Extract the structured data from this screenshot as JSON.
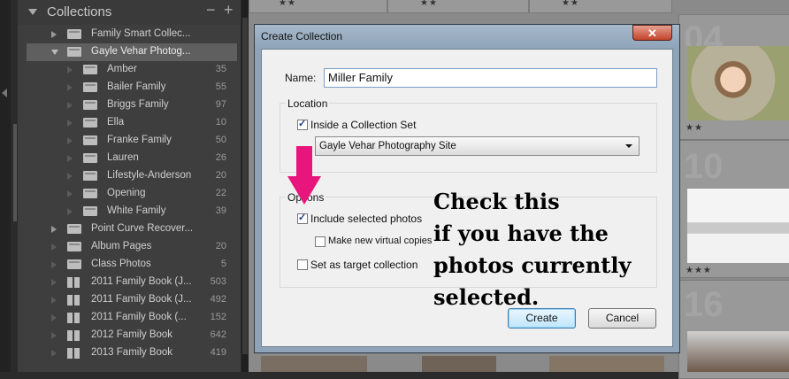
{
  "collections_panel": {
    "title": "Collections",
    "minus_label": "−",
    "plus_label": "+",
    "items": [
      {
        "label": "Family Smart Collec...",
        "count": "",
        "icon": "smart-collection-set-icon",
        "level": 0,
        "disclosure": "collapsed",
        "selected": false
      },
      {
        "label": "Gayle Vehar Photog...",
        "count": "",
        "icon": "collection-set-icon",
        "level": 0,
        "disclosure": "expanded",
        "selected": true
      },
      {
        "label": "Amber",
        "count": "35",
        "icon": "collection-icon",
        "level": 1,
        "disclosure": "none",
        "selected": false
      },
      {
        "label": "Bailer Family",
        "count": "55",
        "icon": "collection-icon",
        "level": 1,
        "disclosure": "none",
        "selected": false
      },
      {
        "label": "Briggs Family",
        "count": "97",
        "icon": "collection-icon",
        "level": 1,
        "disclosure": "none",
        "selected": false
      },
      {
        "label": "Ella",
        "count": "10",
        "icon": "collection-icon",
        "level": 1,
        "disclosure": "none",
        "selected": false
      },
      {
        "label": "Franke Family",
        "count": "50",
        "icon": "collection-icon",
        "level": 1,
        "disclosure": "none",
        "selected": false
      },
      {
        "label": "Lauren",
        "count": "26",
        "icon": "collection-icon",
        "level": 1,
        "disclosure": "none",
        "selected": false
      },
      {
        "label": "Lifestyle-Anderson",
        "count": "20",
        "icon": "collection-icon",
        "level": 1,
        "disclosure": "none",
        "selected": false
      },
      {
        "label": "Opening",
        "count": "22",
        "icon": "collection-icon",
        "level": 1,
        "disclosure": "none",
        "selected": false
      },
      {
        "label": "White Family",
        "count": "39",
        "icon": "collection-icon",
        "level": 1,
        "disclosure": "none",
        "selected": false
      },
      {
        "label": "Point Curve Recover...",
        "count": "",
        "icon": "collection-set-icon",
        "level": 0,
        "disclosure": "collapsed",
        "selected": false
      },
      {
        "label": "Album Pages",
        "count": "20",
        "icon": "collection-icon",
        "level": 0,
        "disclosure": "none",
        "selected": false
      },
      {
        "label": "Class Photos",
        "count": "5",
        "icon": "collection-icon",
        "level": 0,
        "disclosure": "none",
        "selected": false
      },
      {
        "label": "2011 Family Book (J...",
        "count": "503",
        "icon": "book-icon",
        "level": 0,
        "disclosure": "none",
        "selected": false
      },
      {
        "label": "2011 Family Book (J...",
        "count": "492",
        "icon": "book-icon",
        "level": 0,
        "disclosure": "none",
        "selected": false
      },
      {
        "label": "2011 Family Book (...",
        "count": "152",
        "icon": "book-icon",
        "level": 0,
        "disclosure": "none",
        "selected": false
      },
      {
        "label": "2012 Family Book",
        "count": "642",
        "icon": "book-icon",
        "level": 0,
        "disclosure": "none",
        "selected": false
      },
      {
        "label": "2013 Family Book",
        "count": "419",
        "icon": "book-icon",
        "level": 0,
        "disclosure": "none",
        "selected": false
      }
    ]
  },
  "grid": {
    "top_stars": [
      "★★",
      "★★",
      "★★"
    ],
    "cells": [
      {
        "number": "04",
        "stars": "★★"
      },
      {
        "number": "10",
        "stars": "★★★"
      },
      {
        "number": "16",
        "stars": ""
      }
    ]
  },
  "dialog": {
    "title": "Create Collection",
    "close_label": "✕",
    "name_label": "Name:",
    "name_value": "Miller Family",
    "location_legend": "Location",
    "inside_set_label": "Inside a Collection Set",
    "inside_set_checked": true,
    "set_select_value": "Gayle Vehar Photography Site",
    "options_legend": "Options",
    "include_selected_label": "Include selected photos",
    "include_selected_checked": true,
    "virtual_copies_label": "Make new virtual copies",
    "virtual_copies_checked": false,
    "target_label": "Set as target collection",
    "target_checked": false,
    "create_label": "Create",
    "cancel_label": "Cancel"
  },
  "annotation": {
    "lines": [
      "Check this",
      "if you have the",
      "photos currently",
      "selected."
    ],
    "arrow_color": "#e8157d"
  }
}
